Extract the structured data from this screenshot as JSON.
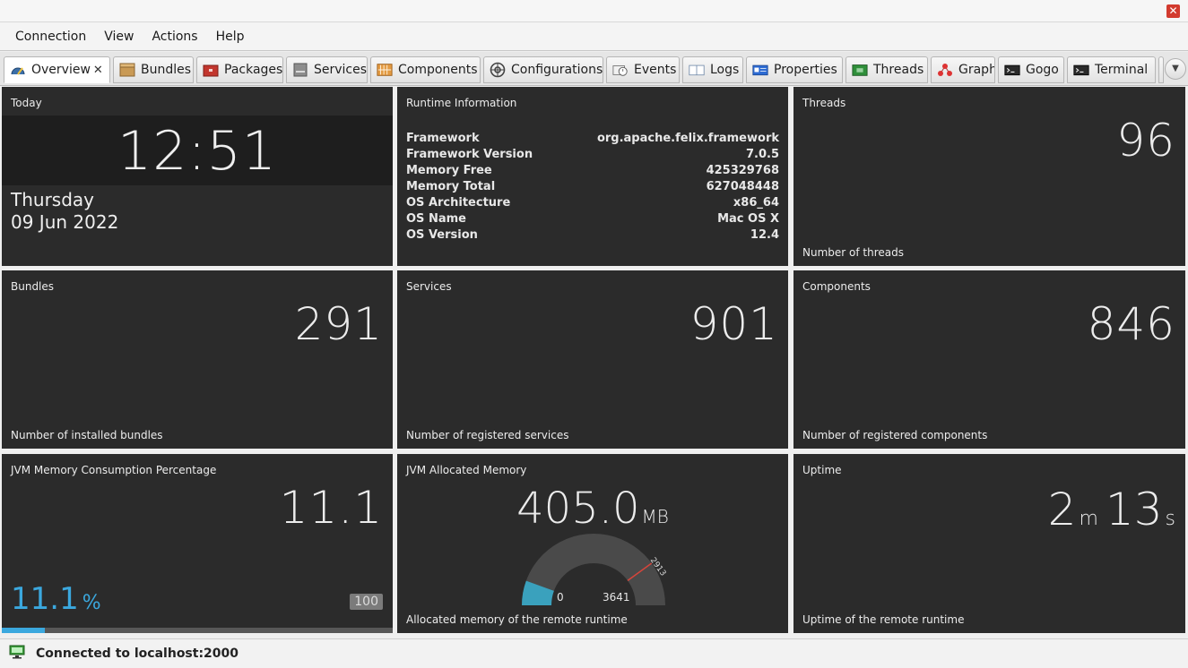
{
  "window": {
    "close_glyph": "✕"
  },
  "menu": [
    "Connection",
    "View",
    "Actions",
    "Help"
  ],
  "tabs": [
    {
      "label": "Overview",
      "icon": "speedometer-icon",
      "active": true,
      "close": "✕"
    },
    {
      "label": "Bundles",
      "icon": "package-box-icon"
    },
    {
      "label": "Packages",
      "icon": "package-red-icon"
    },
    {
      "label": "Services",
      "icon": "server-icon"
    },
    {
      "label": "Components",
      "icon": "components-grid-icon"
    },
    {
      "label": "Configurations",
      "icon": "gear-icon"
    },
    {
      "label": "Events",
      "icon": "events-clock-icon"
    },
    {
      "label": "Logs",
      "icon": "log-book-icon"
    },
    {
      "label": "Properties",
      "icon": "properties-card-icon"
    },
    {
      "label": "Threads",
      "icon": "threads-chip-icon"
    },
    {
      "label": "Graph",
      "icon": "graph-nodes-icon"
    },
    {
      "label": "Gogo",
      "icon": "gogo-terminal-icon"
    },
    {
      "label": "Terminal",
      "icon": "terminal-icon"
    }
  ],
  "tiles": {
    "today": {
      "title": "Today",
      "time": "12:51",
      "day": "Thursday",
      "date": "09 Jun 2022"
    },
    "runtime": {
      "title": "Runtime Information",
      "rows": [
        {
          "key": "Framework",
          "value": "org.apache.felix.framework"
        },
        {
          "key": "Framework Version",
          "value": "7.0.5"
        },
        {
          "key": "Memory Free",
          "value": "425329768"
        },
        {
          "key": "Memory Total",
          "value": "627048448"
        },
        {
          "key": "OS Architecture",
          "value": "x86_64"
        },
        {
          "key": "OS Name",
          "value": "Mac OS X"
        },
        {
          "key": "OS Version",
          "value": "12.4"
        }
      ]
    },
    "threads": {
      "title": "Threads",
      "value": "96",
      "caption": "Number of threads"
    },
    "bundles": {
      "title": "Bundles",
      "value": "291",
      "caption": "Number of installed bundles"
    },
    "services": {
      "title": "Services",
      "value": "901",
      "caption": "Number of registered services"
    },
    "components": {
      "title": "Components",
      "value": "846",
      "caption": "Number of registered components"
    },
    "jvm_memory": {
      "title": "JVM Memory Consumption Percentage",
      "value": "11.1",
      "bar_label": "11.1",
      "unit": "%",
      "max": "100",
      "fraction": 0.111
    },
    "allocated": {
      "title": "JVM Allocated Memory",
      "value": "405.0",
      "unit": "MB",
      "min_label": "0",
      "max_label": "3641",
      "threshold_label": "2913",
      "gauge_min": 0,
      "gauge_max": 3641,
      "threshold": 2913,
      "current": 405.0,
      "caption": "Allocated memory of the remote runtime"
    },
    "uptime": {
      "title": "Uptime",
      "minutes": "2",
      "minutes_unit": "m",
      "seconds": "13",
      "seconds_unit": "s",
      "caption": "Uptime of the remote runtime"
    }
  },
  "colors": {
    "tile_bg": "#2b2b2b",
    "accent_blue": "#3ba8de",
    "threshold_red": "#d6453b",
    "close_red": "#d23a2e"
  },
  "status": {
    "text": "Connected to localhost:2000",
    "icon": "monitor-connected-icon"
  }
}
